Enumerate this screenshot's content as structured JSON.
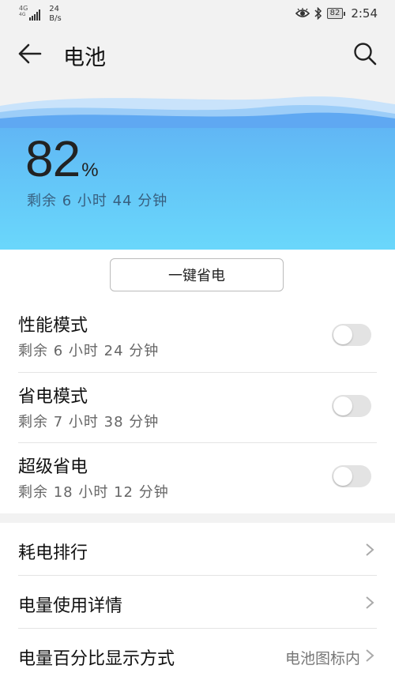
{
  "status_bar": {
    "network": "4G",
    "network_sub": "4G",
    "speed_value": "24",
    "speed_unit": "B/s",
    "battery": "82",
    "time": "2:54"
  },
  "header": {
    "title": "电池"
  },
  "battery": {
    "percent": "82",
    "percent_sign": "%",
    "remaining": "剩余 6 小时 44 分钟",
    "level": 0.82
  },
  "actions": {
    "one_key_save": "一键省电"
  },
  "modes": [
    {
      "title": "性能模式",
      "remaining": "剩余 6 小时 24 分钟",
      "enabled": false
    },
    {
      "title": "省电模式",
      "remaining": "剩余 7 小时 38 分钟",
      "enabled": false
    },
    {
      "title": "超级省电",
      "remaining": "剩余 18 小时 12 分钟",
      "enabled": false
    }
  ],
  "links": [
    {
      "title": "耗电排行",
      "value": ""
    },
    {
      "title": "电量使用详情",
      "value": ""
    },
    {
      "title": "电量百分比显示方式",
      "value": "电池图标内"
    }
  ],
  "colors": {
    "hero_top": "#5fa8f2",
    "hero_bottom": "#6ad7fb",
    "toggle_off": "#e3e3e3"
  }
}
